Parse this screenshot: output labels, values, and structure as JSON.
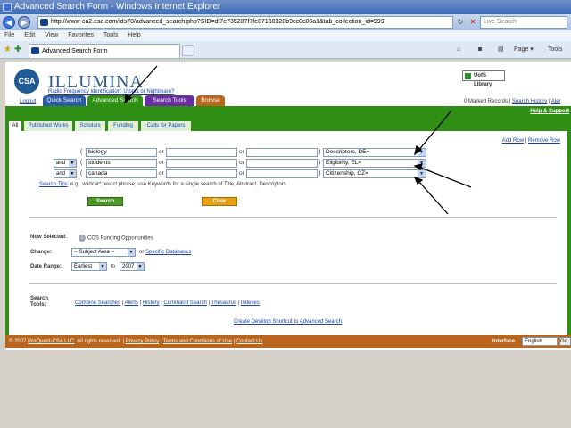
{
  "window": {
    "title": "Advanced Search Form - Windows Internet Explorer"
  },
  "address": {
    "url": "http://www-ca2.csa.com/ids70/advanced_search.php?SID=df7e735287f7fe07160328b9cc0c86a1&tab_collection_id=999"
  },
  "live_search": {
    "placeholder": "Live Search"
  },
  "menu": [
    "File",
    "Edit",
    "View",
    "Favorites",
    "Tools",
    "Help"
  ],
  "browser_tab": {
    "label": "Advanced Search Form"
  },
  "toolbar_right": {
    "page": "Page ▾",
    "tools": "Tools"
  },
  "brand": {
    "logo": "CSA",
    "name": "ILLUMINA",
    "tagline": "Radio Frequency Identification: Utopia or Nightmare?"
  },
  "library": {
    "label": "UofS Library"
  },
  "top_links": {
    "logout": "Logout",
    "marked": "0 Marked Records",
    "history": "Search History",
    "alerts": "Aler"
  },
  "main_tabs": [
    {
      "label": "Quick Search",
      "color": "#2c5aa6"
    },
    {
      "label": "Advanced Search",
      "color": "#2f8f14"
    },
    {
      "label": "Search Tools",
      "color": "#6a2ea0"
    },
    {
      "label": "Browse",
      "color": "#b9651d"
    }
  ],
  "help": "Help & Support",
  "subtabs": [
    "All",
    "Published Works",
    "Scholars",
    "Funding",
    "Calls for Papers"
  ],
  "row_links": {
    "add": "Add Row",
    "remove": "Remove Row"
  },
  "search_rows": [
    {
      "bool": "",
      "terms": [
        "biology",
        "",
        ""
      ],
      "field": "Descriptors, DE="
    },
    {
      "bool": "and",
      "terms": [
        "students",
        "",
        ""
      ],
      "field": "Eligibility, EL="
    },
    {
      "bool": "and",
      "terms": [
        "canada",
        "",
        ""
      ],
      "field": "Citizenship, CZ="
    }
  ],
  "or_label": "or",
  "tips": {
    "link": "Search Tips",
    "text": ": e.g., wildcar*, exact phrase; use Keywords for a single search of Title, Abstract, Descriptors"
  },
  "buttons": {
    "search": "Search",
    "clear": "Clear"
  },
  "now_selected": {
    "label": "Now Selected:",
    "value": "COS Funding Opportunities"
  },
  "change": {
    "label": "Change:",
    "select": "-- Subject Area --",
    "or": "or",
    "link": "Specific Databases"
  },
  "date_range": {
    "label": "Date Range:",
    "from": "Earliest",
    "to_label": "to",
    "to": "2007"
  },
  "search_tools": {
    "label1": "Search",
    "label2": "Tools:",
    "links": [
      "Combine Searches",
      "Alerts",
      "History",
      "Command Search",
      "Thesaurus",
      "Indexes"
    ]
  },
  "desktop_shortcut": "Create Desktop Shortcut to Advanced Search",
  "footer": {
    "copyright": "© 2007 ",
    "company": "ProQuest-CSA LLC",
    "rights": ". All rights reserved.",
    "links": [
      "Privacy Policy",
      "Terms and Conditions of Use",
      "Contact Us"
    ],
    "interface": "Interface",
    "language": "English",
    "go": "Go"
  }
}
